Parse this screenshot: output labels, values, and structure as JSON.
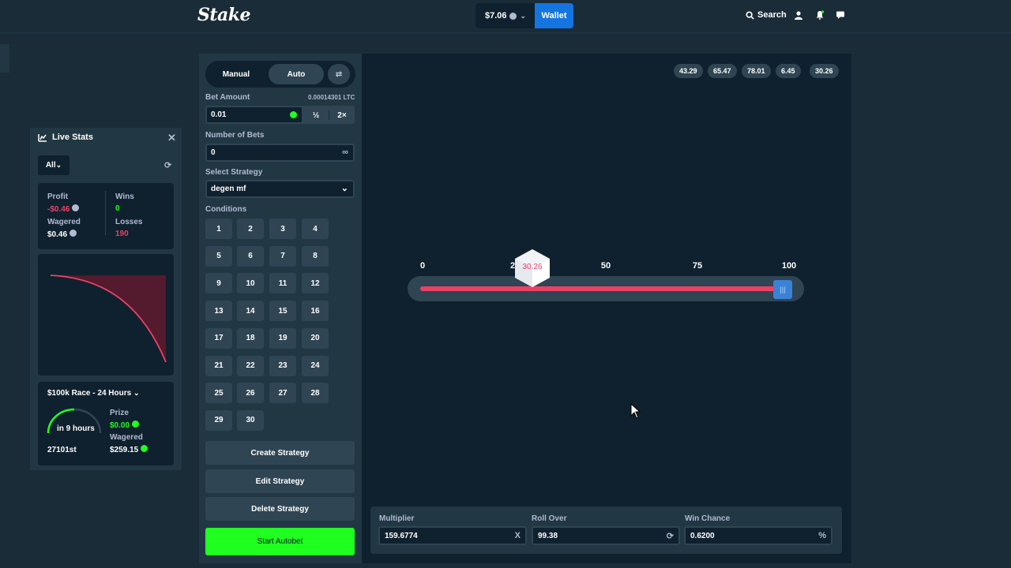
{
  "header": {
    "logo": "Stake",
    "balance": "$7.06",
    "wallet_label": "Wallet",
    "search_label": "Search"
  },
  "live_stats": {
    "title": "Live Stats",
    "filter": "All",
    "profit_label": "Profit",
    "profit_value": "-$0.46",
    "wins_label": "Wins",
    "wins_value": "0",
    "wagered_label": "Wagered",
    "wagered_value": "$0.46",
    "losses_label": "Losses",
    "losses_value": "190",
    "race": {
      "title": "$100k Race - 24 Hours",
      "time_left": "in 9 hours",
      "prize_label": "Prize",
      "prize_value": "$0.00",
      "wagered_label": "Wagered",
      "wagered_value": "$259.15",
      "rank": "27101st"
    },
    "colors": {
      "profit_line": "#ed4163",
      "win": "#1fff20"
    }
  },
  "bet_panel": {
    "tab_manual": "Manual",
    "tab_auto": "Auto",
    "bet_amount_label": "Bet Amount",
    "bet_amount_ltc": "0.00014301 LTC",
    "bet_amount_value": "0.01",
    "half_label": "½",
    "double_label": "2×",
    "num_bets_label": "Number of Bets",
    "num_bets_value": "0",
    "strategy_label": "Select Strategy",
    "strategy_value": "degen mf",
    "conditions_label": "Conditions",
    "conditions": [
      "1",
      "2",
      "3",
      "4",
      "5",
      "6",
      "7",
      "8",
      "9",
      "10",
      "11",
      "12",
      "13",
      "14",
      "15",
      "16",
      "17",
      "18",
      "19",
      "20",
      "21",
      "22",
      "23",
      "24",
      "25",
      "26",
      "27",
      "28",
      "29",
      "30"
    ],
    "create_strategy": "Create Strategy",
    "edit_strategy": "Edit Strategy",
    "delete_strategy": "Delete Strategy",
    "start_autobet": "Start Autobet"
  },
  "game": {
    "recent_results": [
      "43.29",
      "65.47",
      "78.01",
      "6.45",
      "30.26"
    ],
    "scale": [
      "0",
      "25",
      "50",
      "75",
      "100"
    ],
    "scale_visible_25": "2",
    "roll_result": "30.26",
    "multiplier_label": "Multiplier",
    "multiplier_value": "159.6774",
    "multiplier_suffix": "X",
    "roll_over_label": "Roll Over",
    "roll_over_value": "99.38",
    "win_chance_label": "Win Chance",
    "win_chance_value": "0.6200",
    "win_chance_suffix": "%",
    "colors": {
      "lose": "#ed4163",
      "handle": "#3b82d6",
      "accent_green": "#1fff20"
    }
  }
}
